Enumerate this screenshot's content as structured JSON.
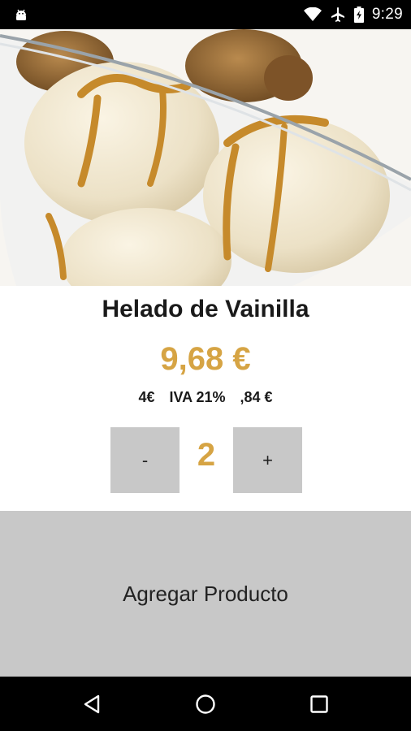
{
  "status_bar": {
    "time": "9:29",
    "icons": [
      "android-icon",
      "wifi-icon",
      "airplane-icon",
      "battery-charging-icon"
    ]
  },
  "product": {
    "image": "vanilla-ice-cream-image",
    "name": "Helado de Vainilla",
    "price": "9,68 €",
    "base": "4€",
    "tax_label": "IVA 21%",
    "tax_amount": ",84 €"
  },
  "quantity": {
    "minus_label": "-",
    "value": "2",
    "plus_label": "+"
  },
  "add_button": {
    "label": "Agregar Producto"
  },
  "nav_bar": {
    "icons": [
      "back-icon",
      "home-icon",
      "recents-icon"
    ]
  },
  "colors": {
    "accent": "#d6a444",
    "button_gray": "#c8c8c8",
    "status_bar": "#000000"
  }
}
